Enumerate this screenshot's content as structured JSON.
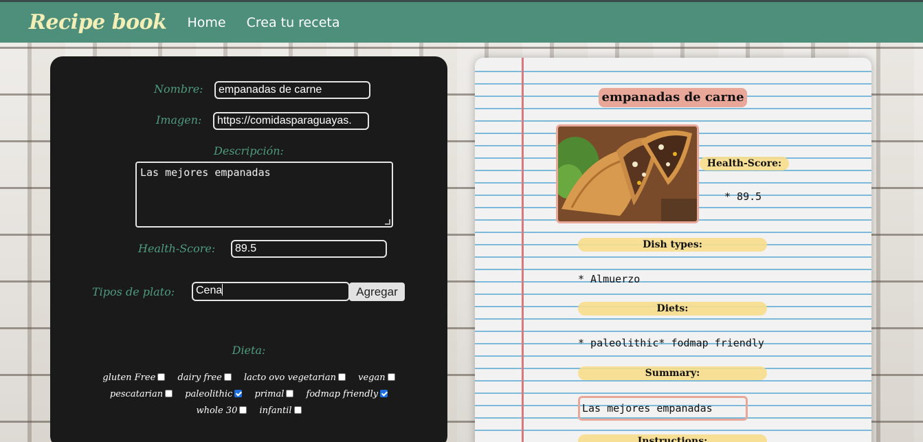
{
  "navbar": {
    "brand": "Recipe book",
    "links": [
      "Home",
      "Crea tu receta"
    ]
  },
  "form": {
    "name_label": "Nombre:",
    "name_value": "empanadas de carne",
    "image_label": "Imagen:",
    "image_value": "https://comidasparaguayas.",
    "description_label": "Descripción:",
    "description_value": "Las mejores empanadas",
    "health_label": "Health-Score:",
    "health_value": "89.5",
    "dish_label": "Tipos de plato:",
    "dish_value": "Cena",
    "add_button": "Agregar",
    "diet_title": "Dieta:",
    "diets": [
      {
        "label": "gluten Free",
        "checked": false
      },
      {
        "label": "dairy free",
        "checked": false
      },
      {
        "label": "lacto ovo vegetarian",
        "checked": false
      },
      {
        "label": "vegan",
        "checked": false
      },
      {
        "label": "pescatarian",
        "checked": false
      },
      {
        "label": "paleolithic",
        "checked": true
      },
      {
        "label": "primal",
        "checked": false
      },
      {
        "label": "fodmap friendly",
        "checked": true
      },
      {
        "label": "whole 30",
        "checked": false
      },
      {
        "label": "infantil",
        "checked": false
      }
    ]
  },
  "preview": {
    "title": "empanadas de carne",
    "health_label": "Health-Score:",
    "health_value": "* 89.5",
    "dish_types_label": "Dish types:",
    "dish_types_value": "* Almuerzo",
    "diets_label": "Diets:",
    "diets_value": "* paleolithic* fodmap friendly",
    "summary_label": "Summary:",
    "summary_value": "Las mejores empanadas",
    "instructions_label": "Instructions:"
  },
  "colors": {
    "navbar": "#4e8f7c",
    "brand": "#f3efb6",
    "form_label": "#4e9b7e",
    "panel": "#1b1a1b",
    "highlight": "#f7de8c",
    "accent_pink": "#e9a79a"
  }
}
